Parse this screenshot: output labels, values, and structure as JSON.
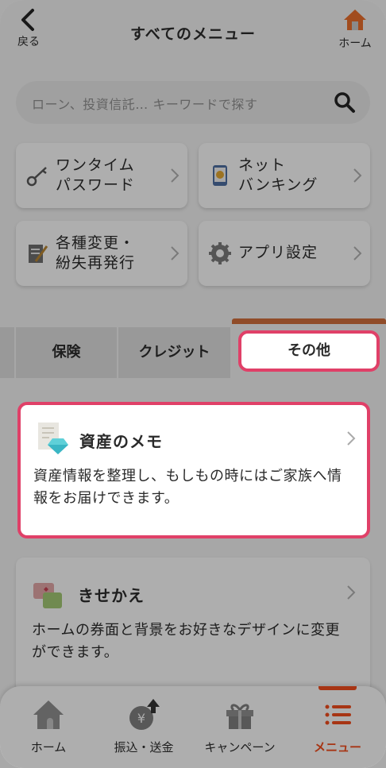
{
  "header": {
    "back_label": "戻る",
    "title": "すべてのメニュー",
    "home_label": "ホーム"
  },
  "search": {
    "placeholder": "ローン、投資信託… キーワードで探す"
  },
  "tiles": [
    {
      "label": "ワンタイム\nパスワード",
      "icon": "key-icon"
    },
    {
      "label": "ネット\nバンキング",
      "icon": "smartphone-yen-icon"
    },
    {
      "label": "各種変更・\n紛失再発行",
      "icon": "document-pen-icon"
    },
    {
      "label": "アプリ設定",
      "icon": "gear-icon"
    }
  ],
  "tabs": [
    {
      "label": "保険",
      "selected": false
    },
    {
      "label": "クレジット",
      "selected": false
    },
    {
      "label": "その他",
      "selected": true
    }
  ],
  "cards": [
    {
      "title": "資産のメモ",
      "desc": "資産情報を整理し、もしもの時にはご家族へ情報をお届けできます。",
      "icon": "diamond-memo-icon",
      "highlighted": true
    },
    {
      "title": "きせかえ",
      "desc": "ホームの券面と背景をお好きなデザインに変更ができます。",
      "icon": "card-cards-icon",
      "highlighted": false
    }
  ],
  "bottom_nav": [
    {
      "label": "ホーム",
      "icon": "home-icon",
      "active": false
    },
    {
      "label": "振込・送金",
      "icon": "yen-coin-icon",
      "active": false
    },
    {
      "label": "キャンペーン",
      "icon": "gift-icon",
      "active": false
    },
    {
      "label": "メニュー",
      "icon": "menu-list-icon",
      "active": true
    }
  ],
  "colors": {
    "accent": "#e84a1c",
    "highlight_border": "#e04068",
    "tab_bar": "#c86a3a"
  }
}
